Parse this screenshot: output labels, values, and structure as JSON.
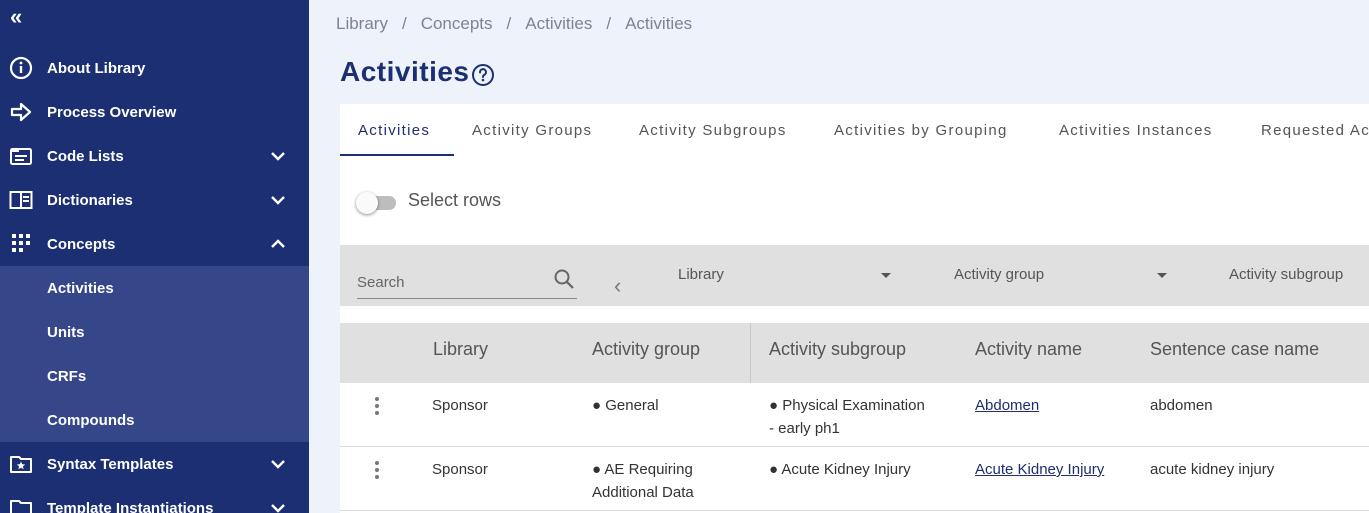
{
  "sidebar": {
    "collapse_glyph": "«",
    "items": [
      {
        "label": "About Library",
        "icon": "info-icon",
        "chevron": ""
      },
      {
        "label": "Process Overview",
        "icon": "arrow-right-icon",
        "chevron": ""
      },
      {
        "label": "Code Lists",
        "icon": "list-box-icon",
        "chevron": "down"
      },
      {
        "label": "Dictionaries",
        "icon": "book-open-icon",
        "chevron": "down"
      },
      {
        "label": "Concepts",
        "icon": "hierarchy-icon",
        "chevron": "up"
      }
    ],
    "concepts_children": [
      {
        "label": "Activities"
      },
      {
        "label": "Units"
      },
      {
        "label": "CRFs"
      },
      {
        "label": "Compounds"
      }
    ],
    "items_after": [
      {
        "label": "Syntax Templates",
        "icon": "star-folder-icon",
        "chevron": "down"
      },
      {
        "label": "Template Instantiations",
        "icon": "folder-icon",
        "chevron": "down"
      }
    ]
  },
  "breadcrumb": [
    "Library",
    "Concepts",
    "Activities",
    "Activities"
  ],
  "breadcrumb_separator": "/",
  "page": {
    "title": "Activities"
  },
  "tabs": [
    {
      "label": "Activities",
      "active": true
    },
    {
      "label": "Activity Groups"
    },
    {
      "label": "Activity Subgroups"
    },
    {
      "label": "Activities by Grouping"
    },
    {
      "label": "Activities Instances"
    },
    {
      "label": "Requested Ac"
    }
  ],
  "select_rows": {
    "label": "Select rows",
    "enabled": false
  },
  "filters": {
    "search_placeholder": "Search",
    "prev_glyph": "‹",
    "library": "Library",
    "activity_group": "Activity group",
    "activity_subgroup": "Activity subgroup"
  },
  "table": {
    "headers": [
      "Library",
      "Activity group",
      "Activity subgroup",
      "Activity name",
      "Sentence case name"
    ],
    "rows": [
      {
        "library": "Sponsor",
        "group": "● General",
        "subgroup_line1": "● Physical Examination",
        "subgroup_line2": "- early ph1",
        "name": "Abdomen",
        "sentence_case": "abdomen"
      },
      {
        "library": "Sponsor",
        "group_line1": "● AE Requiring",
        "group_line2": "Additional Data",
        "subgroup": "● Acute Kidney Injury",
        "name": "Acute Kidney Injury",
        "sentence_case": "acute kidney injury"
      }
    ]
  },
  "colors": {
    "sidebar_bg": "#1c2f72",
    "sidebar_sub_bg": "#354789",
    "accent": "#1c2f72",
    "page_bg": "#eef3fb"
  }
}
